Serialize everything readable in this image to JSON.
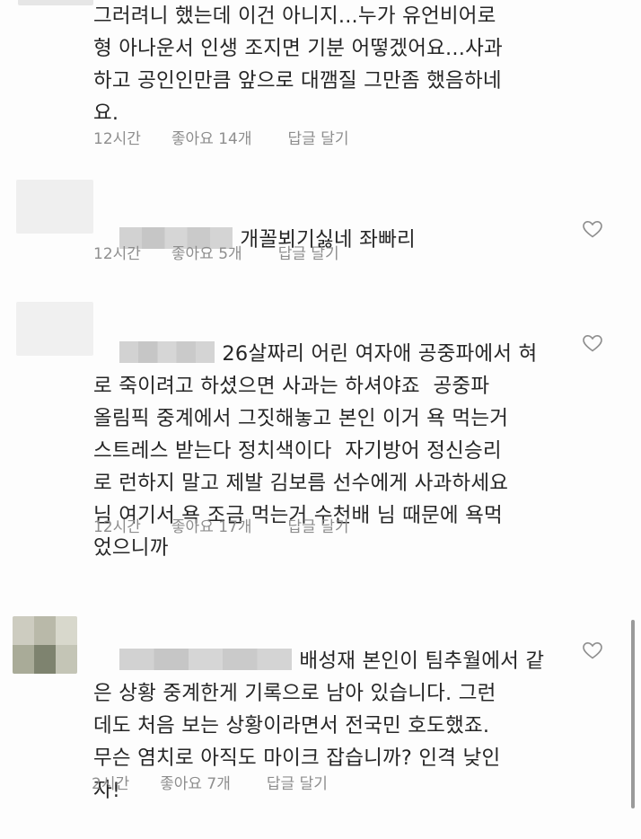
{
  "comments": [
    {
      "lines": "그러려니 했는데 이건 아니지...누가 유언비어로\n형 아나운서 인생 조지면 기분 어떻겠어요...사과\n하고 공인인만큼 앞으로 대깸질 그만좀 했음하네\n요.",
      "time": "12시간",
      "likes": "좋아요 14개",
      "reply": "답글 달기"
    },
    {
      "lines": "개꼴뵈기싫네 좌빠리",
      "time": "12시간",
      "likes": "좋아요 5개",
      "reply": "답글 달기"
    },
    {
      "lines": "26살짜리 어린 여자애 공중파에서 혀\n로 죽이려고 하셨으면 사과는 하셔야죠  공중파\n올림픽 중계에서 그짓해놓고 본인 이거 욕 먹는거\n스트레스 받는다 정치색이다  자기방어 정신승리\n로 런하지 말고 제발 김보름 선수에게 사과하세요\n님 여기서 욕 조금 먹는거 수천배 님 때문에 욕먹\n었으니까",
      "time": "12시간",
      "likes": "좋아요 17개",
      "reply": "답글 달기"
    },
    {
      "lines": "배성재 본인이 팀추월에서 같\n은 상황 중계한게 기록으로 남아 있습니다. 그런\n데도 처음 보는 상황이라면서 전국민 호도했죠.\n무슨 염치로 아직도 마이크 잡습니까? 인격 낮인\n자!",
      "time": "2시간",
      "likes": "좋아요 7개",
      "reply": "답글 달기"
    }
  ],
  "colors": {
    "text": "#262626",
    "meta": "#8e8e8e",
    "background": "#fdfdfd"
  },
  "icons": {
    "like": "heart-outline-icon"
  }
}
